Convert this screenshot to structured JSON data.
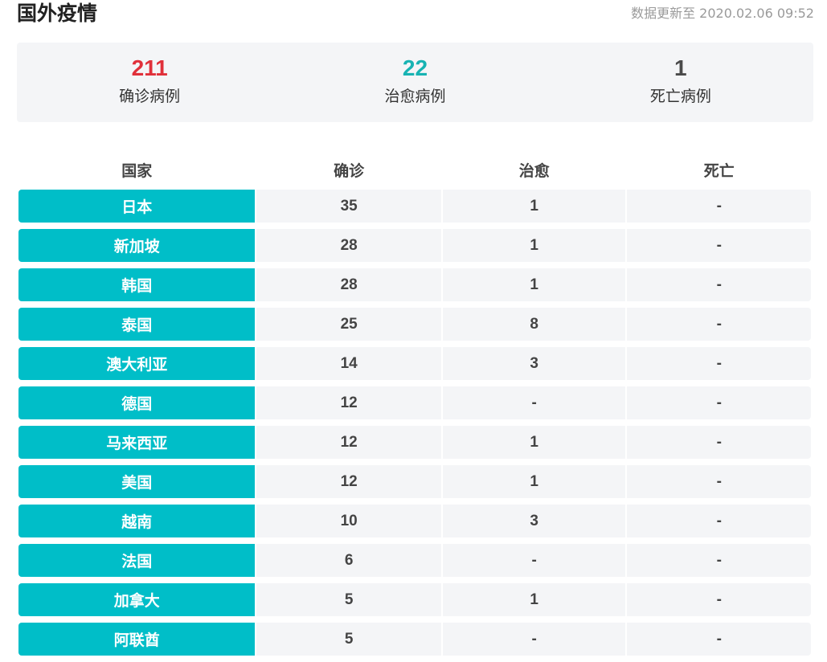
{
  "header": {
    "title": "国外疫情",
    "update_time": "数据更新至 2020.02.06 09:52"
  },
  "summary": [
    {
      "value": "211",
      "label": "确诊病例",
      "color": "#e0303a"
    },
    {
      "value": "22",
      "label": "治愈病例",
      "color": "#17b3b3"
    },
    {
      "value": "1",
      "label": "死亡病例",
      "color": "#4a4a4a"
    }
  ],
  "table": {
    "headers": {
      "country": "国家",
      "confirmed": "确诊",
      "cured": "治愈",
      "dead": "死亡"
    },
    "rows": [
      {
        "country": "日本",
        "confirmed": "35",
        "cured": "1",
        "dead": "-"
      },
      {
        "country": "新加坡",
        "confirmed": "28",
        "cured": "1",
        "dead": "-"
      },
      {
        "country": "韩国",
        "confirmed": "28",
        "cured": "1",
        "dead": "-"
      },
      {
        "country": "泰国",
        "confirmed": "25",
        "cured": "8",
        "dead": "-"
      },
      {
        "country": "澳大利亚",
        "confirmed": "14",
        "cured": "3",
        "dead": "-"
      },
      {
        "country": "德国",
        "confirmed": "12",
        "cured": "-",
        "dead": "-"
      },
      {
        "country": "马来西亚",
        "confirmed": "12",
        "cured": "1",
        "dead": "-"
      },
      {
        "country": "美国",
        "confirmed": "12",
        "cured": "1",
        "dead": "-"
      },
      {
        "country": "越南",
        "confirmed": "10",
        "cured": "3",
        "dead": "-"
      },
      {
        "country": "法国",
        "confirmed": "6",
        "cured": "-",
        "dead": "-"
      },
      {
        "country": "加拿大",
        "confirmed": "5",
        "cured": "1",
        "dead": "-"
      },
      {
        "country": "阿联酋",
        "confirmed": "5",
        "cured": "-",
        "dead": "-"
      }
    ]
  },
  "theme": {
    "country_cell_bg": "#00bec8",
    "cell_bg": "#f4f5f7"
  }
}
